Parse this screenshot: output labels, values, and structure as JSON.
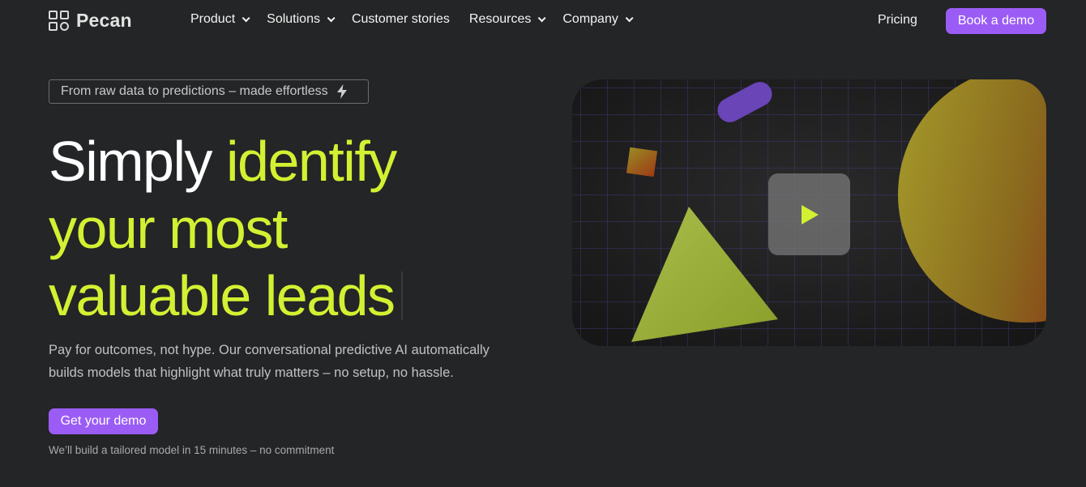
{
  "brand": {
    "name": "Pecan"
  },
  "nav": {
    "items": [
      {
        "label": "Product",
        "dropdown": true
      },
      {
        "label": "Solutions",
        "dropdown": true
      },
      {
        "label": "Customer stories",
        "dropdown": false
      },
      {
        "label": "Resources",
        "dropdown": true
      },
      {
        "label": "Company",
        "dropdown": true
      }
    ],
    "pricing": "Pricing",
    "book_demo": "Book a demo"
  },
  "hero": {
    "tagline": "From raw data to predictions – made effortless",
    "headline_white": "Simply ",
    "headline_green_1": "identify",
    "headline_green_2": "your most",
    "headline_green_3": "valuable leads",
    "subtitle": "Pay for outcomes, not hype. Our conversational predictive AI automatically builds models that highlight what truly matters – no setup, no hassle.",
    "cta": "Get your demo",
    "note": "We’ll build a tailored model in 15 minutes – no commitment"
  },
  "colors": {
    "background": "#232526",
    "accent_green": "#d3f032",
    "accent_purple": "#9b5cf6"
  },
  "icons": [
    "chevron-down-icon",
    "lightning-bolt-icon",
    "play-icon"
  ]
}
